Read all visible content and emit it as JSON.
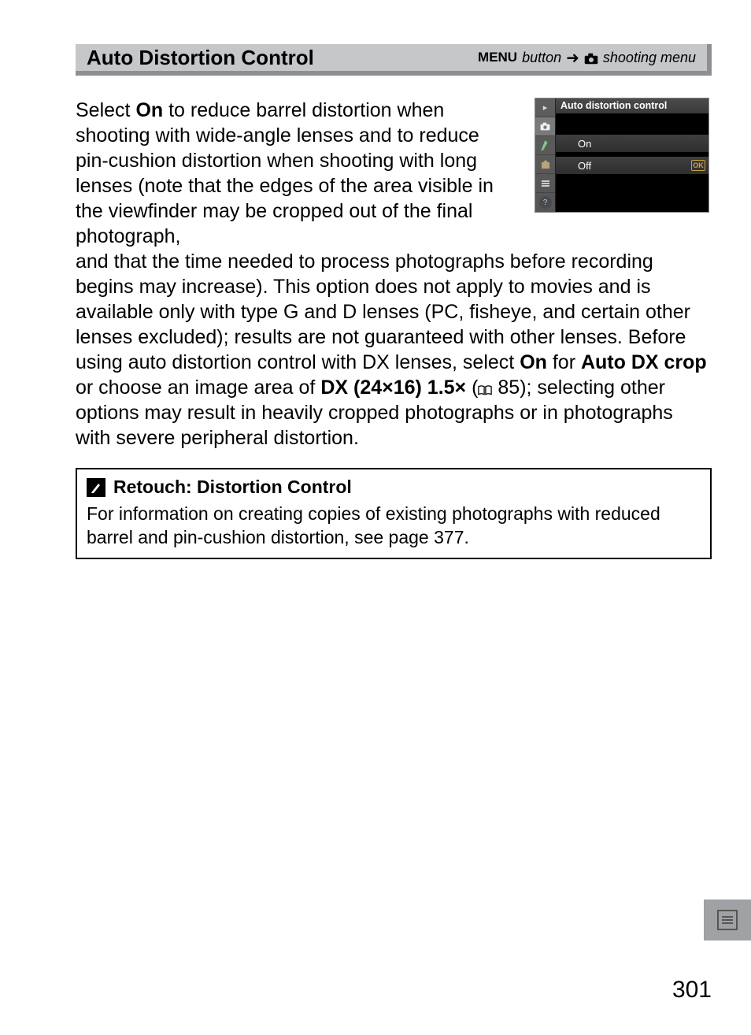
{
  "header": {
    "title": "Auto Distortion Control",
    "right_menu_word": "MENU",
    "right_button_word": "button",
    "right_shooting_menu": "shooting menu"
  },
  "para1": "Select ",
  "para1_on": "On",
  "para1_tail": " to reduce barrel distortion when shooting with wide-angle lenses and to reduce pin-cushion distortion when shooting with long lenses (note that the edges of the area visible in the viewfinder may be cropped out of the final photograph,",
  "para2_a": "and that the time needed to process photographs before recording begins may increase).  This option does not apply to movies and is available only with type G and D lenses (PC, fisheye, and certain other lenses excluded); results are not guaranteed with other lenses.  Before using auto distortion control with DX lenses, select ",
  "para2_on": "On",
  "para2_b": " for ",
  "para2_autodx": "Auto DX crop",
  "para2_c": " or choose an image area of ",
  "para2_dx": "DX (24×16) 1.5×",
  "para2_d": " (",
  "para2_ref": " 85); selecting other options may result in heavily cropped photographs or in photographs with severe peripheral distortion.",
  "lcd": {
    "title": "Auto distortion control",
    "option_on": "On",
    "option_off": "Off",
    "ok": "OK"
  },
  "callout": {
    "title": "Retouch: Distortion Control",
    "body": "For information on creating copies of existing photographs with reduced barrel and pin-cushion distortion, see page 377."
  },
  "page_number": "301"
}
